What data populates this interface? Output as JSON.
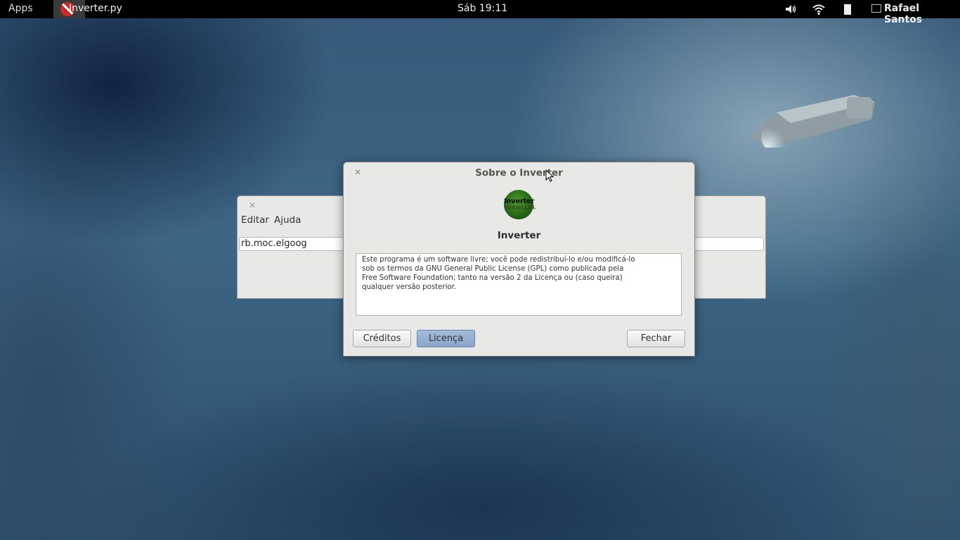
{
  "topbar": {
    "apps": "Apps",
    "app_name": "Inverter.py",
    "clock": "Sáb 19:11",
    "user": "Rafael Santos",
    "icons": [
      "volume-icon",
      "wifi-icon",
      "battery-icon",
      "user-status-icon"
    ]
  },
  "main_window": {
    "menu_edit": "Editar",
    "menu_help": "Ajuda",
    "input_value": "rb.moc.elgoog"
  },
  "about_dialog": {
    "title": "Sobre o Inverter",
    "logo_text": "Inverter",
    "program_name": "Inverter",
    "license_lines": [
      "Este programa é um software livre; você pode redistribuí-lo e/ou modificá-lo",
      "sob os termos da GNU General Public License (GPL) como publicada pela",
      "Free Software Foundation; tanto na versão 2 da Licença ou (caso queira)",
      "qualquer versão posterior."
    ],
    "buttons": {
      "credits": "Créditos",
      "license": "Licença",
      "close": "Fechar"
    }
  },
  "colors": {
    "topbar_bg": "#000000",
    "dialog_bg": "#e8e8e7",
    "active_button": "#8aa6c9",
    "logo_green": "#2e7a1e"
  }
}
